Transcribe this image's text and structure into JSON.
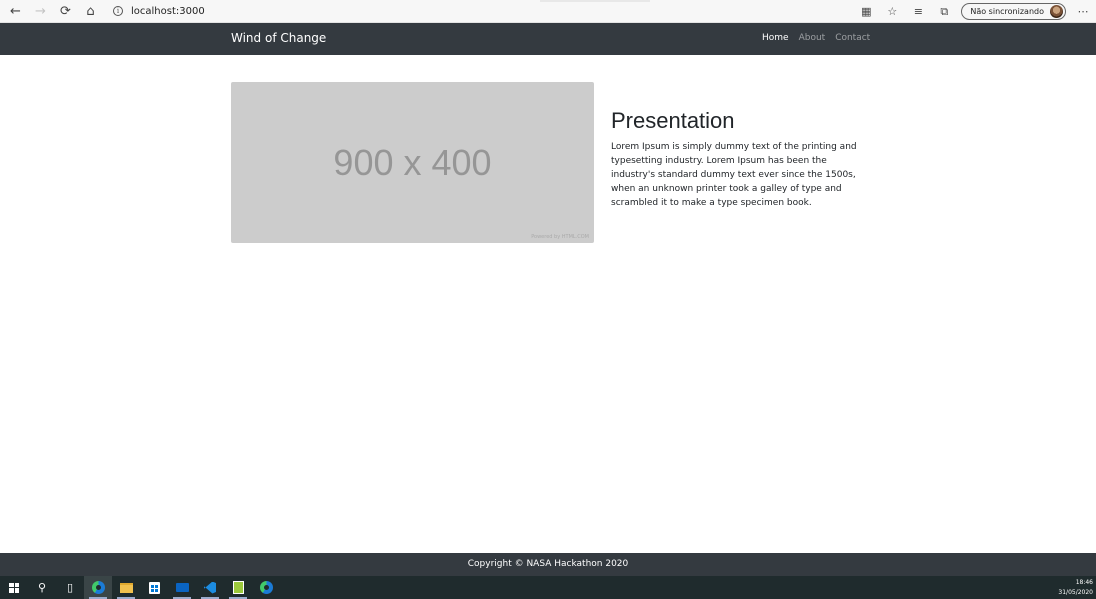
{
  "browser": {
    "url": "localhost:3000",
    "sync_label": "Não sincronizando"
  },
  "navbar": {
    "brand": "Wind of Change",
    "links": [
      {
        "label": "Home",
        "active": true
      },
      {
        "label": "About",
        "active": false
      },
      {
        "label": "Contact",
        "active": false
      }
    ]
  },
  "hero": {
    "image_text": "900 x 400",
    "image_credit": "Powered by HTML.COM",
    "title": "Presentation",
    "body": "Lorem Ipsum is simply dummy text of the printing and typesetting industry. Lorem Ipsum has been the industry's standard dummy text ever since the 1500s, when an unknown printer took a galley of type and scrambled it to make a type specimen book."
  },
  "footer": {
    "copyright": "Copyright © NASA Hackathon 2020"
  },
  "taskbar": {
    "time": "18:46",
    "date": "31/05/2020"
  },
  "colors": {
    "navbar_bg": "#343a40",
    "placeholder_bg": "#cccccc",
    "taskbar_bg": "#1f2b2d"
  }
}
